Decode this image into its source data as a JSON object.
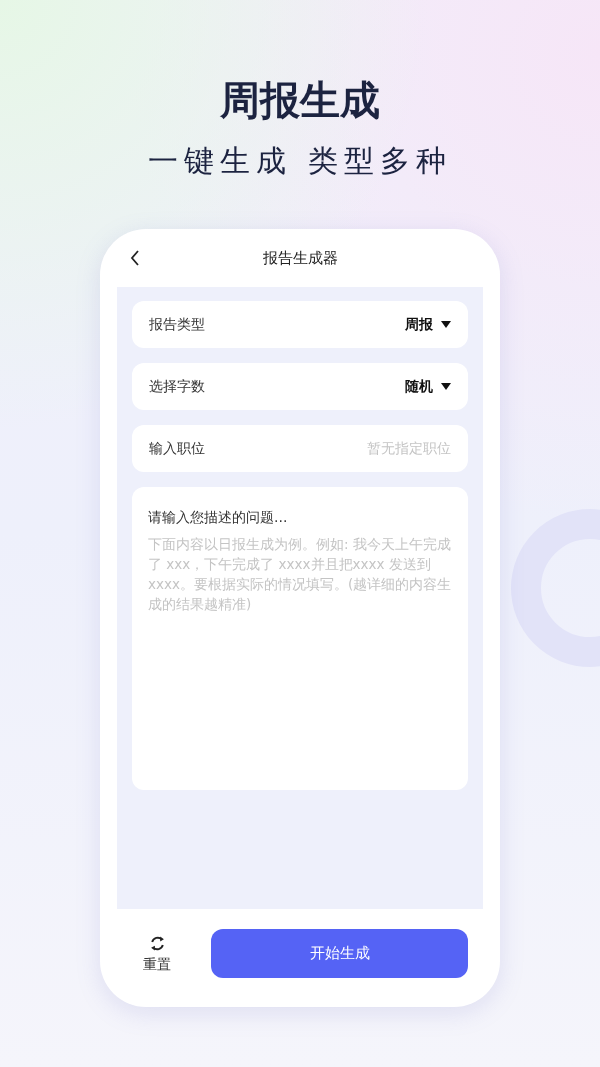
{
  "headline": "周报生成",
  "subtitle": "一键生成 类型多种",
  "screen": {
    "title": "报告生成器",
    "fields": [
      {
        "kind": "select",
        "label": "报告类型",
        "value": "周报"
      },
      {
        "kind": "select",
        "label": "选择字数",
        "value": "随机"
      },
      {
        "kind": "input",
        "label": "输入职位",
        "placeholder": "暂无指定职位"
      }
    ],
    "description": {
      "label": "请输入您描述的问题...",
      "placeholder": "下面内容以日报生成为例。例如: 我今天上午完成了 xxx，下午完成了 xxxx并且把xxxx 发送到 xxxx。要根据实际的情况填写。(越详细的内容生成的结果越精准)"
    },
    "reset_button": "重置",
    "start_button": "开始生成"
  }
}
